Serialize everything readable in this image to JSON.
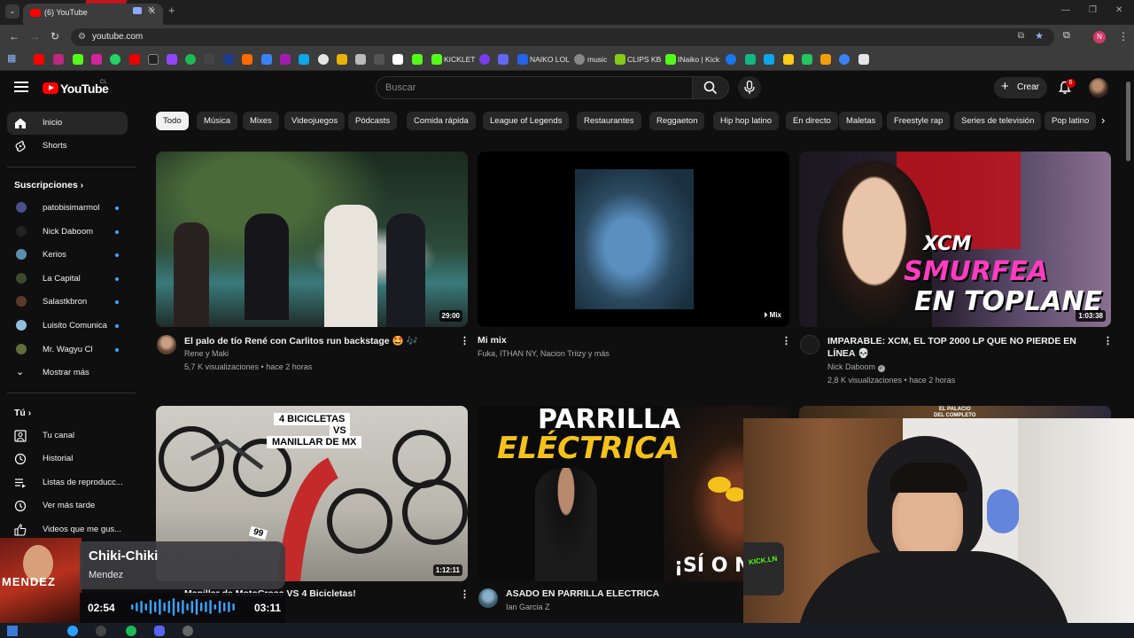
{
  "browser": {
    "tab_title": "(6) YouTube",
    "url": "youtube.com",
    "bookmarks": [
      {
        "label": "KICKLET"
      },
      {
        "label": "NAIKO LOL"
      },
      {
        "label": "music"
      },
      {
        "label": "CLIPS KB"
      },
      {
        "label": "INaiko | Kick"
      }
    ],
    "profile_initial": "N"
  },
  "masthead": {
    "brand": "YouTube",
    "country_code": "CL",
    "search_placeholder": "Buscar",
    "create_label": "Crear",
    "notification_count": "6"
  },
  "sidebar": {
    "main": [
      {
        "label": "Inicio",
        "icon": "home-icon"
      },
      {
        "label": "Shorts",
        "icon": "shorts-icon"
      }
    ],
    "subscriptions_header": "Suscripciones",
    "subscriptions": [
      {
        "label": "patobisimarmol",
        "color": "#4a4f8a"
      },
      {
        "label": "Nick Daboom",
        "color": "#222222"
      },
      {
        "label": "Kerios",
        "color": "#5a8fb0"
      },
      {
        "label": "La Capital",
        "color": "#3e4a2a"
      },
      {
        "label": "Salastkbron",
        "color": "#5b3a2a"
      },
      {
        "label": "Luisito Comunica",
        "color": "#8fbfdc"
      },
      {
        "label": "Mr. Wagyu Cl",
        "color": "#5f6f3a"
      }
    ],
    "show_more": "Mostrar más",
    "you_header": "Tú",
    "you_items": [
      {
        "label": "Tu canal",
        "icon": "channel-icon"
      },
      {
        "label": "Historial",
        "icon": "history-icon"
      },
      {
        "label": "Listas de reproducc...",
        "icon": "playlists-icon"
      },
      {
        "label": "Ver más tarde",
        "icon": "watch-later-icon"
      },
      {
        "label": "Videos que me gus...",
        "icon": "liked-icon"
      }
    ]
  },
  "chips": [
    "Todo",
    "Música",
    "Mixes",
    "Videojuegos",
    "Pódcasts",
    "Comida rápida",
    "League of Legends",
    "Restaurantes",
    "Reggaeton",
    "Hip hop latino",
    "En directo",
    "Maletas",
    "Freestyle rap",
    "Series de televisión",
    "Pop latino"
  ],
  "videos": [
    {
      "title": "El palo de tío René con Carlitos run backstage 🤩 🎶",
      "channel": "Rene y Maki",
      "stats": "5,7 K visualizaciones • hace 2 horas",
      "duration": "29:00"
    },
    {
      "title": "Mi mix",
      "channel": "Fuka, ITHAN NY, Nacion Triizy y más",
      "stats": "",
      "duration": "Mix"
    },
    {
      "title": "IMPARABLE: XCM, EL TOP 2000 LP QUE NO PIERDE EN LÍNEA 💀",
      "channel": "Nick Daboom",
      "stats": "2,8 K visualizaciones • hace 2 horas",
      "duration": "1:03:38",
      "thumb_text": [
        "XCM",
        "SMURFEA",
        "EN TOPLANE"
      ]
    },
    {
      "title": "Manillar de MotoCross VS 4 Bicicletas!",
      "channel": "",
      "stats": "",
      "duration": "1:12:11",
      "thumb_text": [
        "4 BICICLETAS",
        "VS",
        "MANILLAR DE MX",
        "99"
      ]
    },
    {
      "title": "ASADO EN PARRILLA ELECTRICA",
      "channel": "Ian Garcia Z",
      "stats": "",
      "duration": "",
      "thumb_text": [
        "PARRILLA",
        "ELÉCTRICA",
        "¡SÍ O N"
      ]
    },
    {
      "title": "",
      "channel": "",
      "stats": "",
      "duration": "",
      "thumb_text": [
        "EL PALACIO",
        "DEL COMPLETO"
      ]
    }
  ],
  "now_playing": {
    "song": "Chiki-Chiki",
    "artist": "Mendez",
    "elapsed": "02:54",
    "total": "03:11",
    "progress": 0.91,
    "art_text": "MENDEZ"
  },
  "webcam": {
    "overlay_text": "KICK.LN"
  }
}
